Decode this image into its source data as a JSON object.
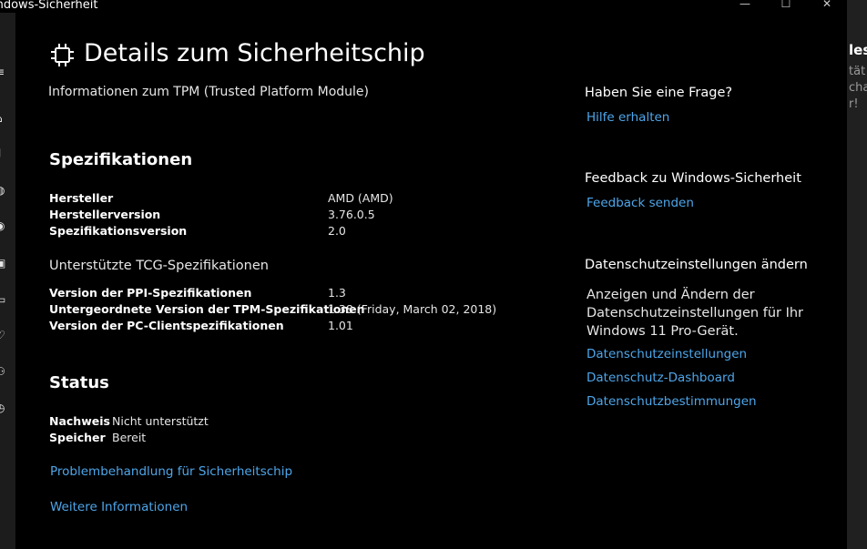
{
  "window": {
    "title": "indows-Sicherheit",
    "minimize_glyph": "—",
    "maximize_glyph": "☐",
    "close_glyph": "✕"
  },
  "page": {
    "title": "Details zum Sicherheitschip",
    "subtitle": "Informationen zum TPM (Trusted Platform Module)"
  },
  "specs": {
    "heading": "Spezifikationen",
    "rows": [
      {
        "label": "Hersteller",
        "value": "AMD (AMD)"
      },
      {
        "label": "Herstellerversion",
        "value": "3.76.0.5"
      },
      {
        "label": "Spezifikationsversion",
        "value": "2.0"
      }
    ],
    "tcg_heading": "Unterstützte TCG-Spezifikationen",
    "tcg_rows": [
      {
        "label": "Version der PPI-Spezifikationen",
        "value": "1.3"
      },
      {
        "label": "Untergeordnete Version der TPM-Spezifikationen",
        "value": "1.38 (Friday, March 02, 2018)"
      },
      {
        "label": "Version der PC-Clientspezifikationen",
        "value": "1.01"
      }
    ]
  },
  "status": {
    "heading": "Status",
    "rows": [
      {
        "label": "Nachweis",
        "value": "Nicht unterstützt"
      },
      {
        "label": "Speicher",
        "value": "Bereit"
      }
    ],
    "troubleshoot_link": "Problembehandlung für Sicherheitschip",
    "more_info_link": "Weitere Informationen"
  },
  "sidebar": {
    "question_heading": "Haben Sie eine Frage?",
    "help_link": "Hilfe erhalten",
    "feedback_heading": "Feedback zu Windows-Sicherheit",
    "feedback_link": "Feedback senden",
    "privacy_heading": "Datenschutzeinstellungen ändern",
    "privacy_text_lines": [
      "Anzeigen und Ändern der",
      "Datenschutzeinstellungen für Ihr",
      "Windows 11 Pro-Gerät."
    ],
    "privacy_links": [
      "Datenschutzeinstellungen",
      "Datenschutz-Dashboard",
      "Datenschutzbestimmungen"
    ]
  },
  "right_edge": {
    "lines": [
      "les",
      "tät",
      "cha",
      "r!"
    ]
  },
  "nav_icons": [
    "back-icon",
    "menu-icon",
    "home-icon",
    "shield-icon",
    "account-icon",
    "firewall-icon",
    "app-browser-icon",
    "device-security-icon",
    "performance-icon",
    "family-icon",
    "history-icon"
  ],
  "colors": {
    "background": "#000000",
    "link": "#4ea6ea",
    "nav_strip": "#1c1c1c"
  }
}
